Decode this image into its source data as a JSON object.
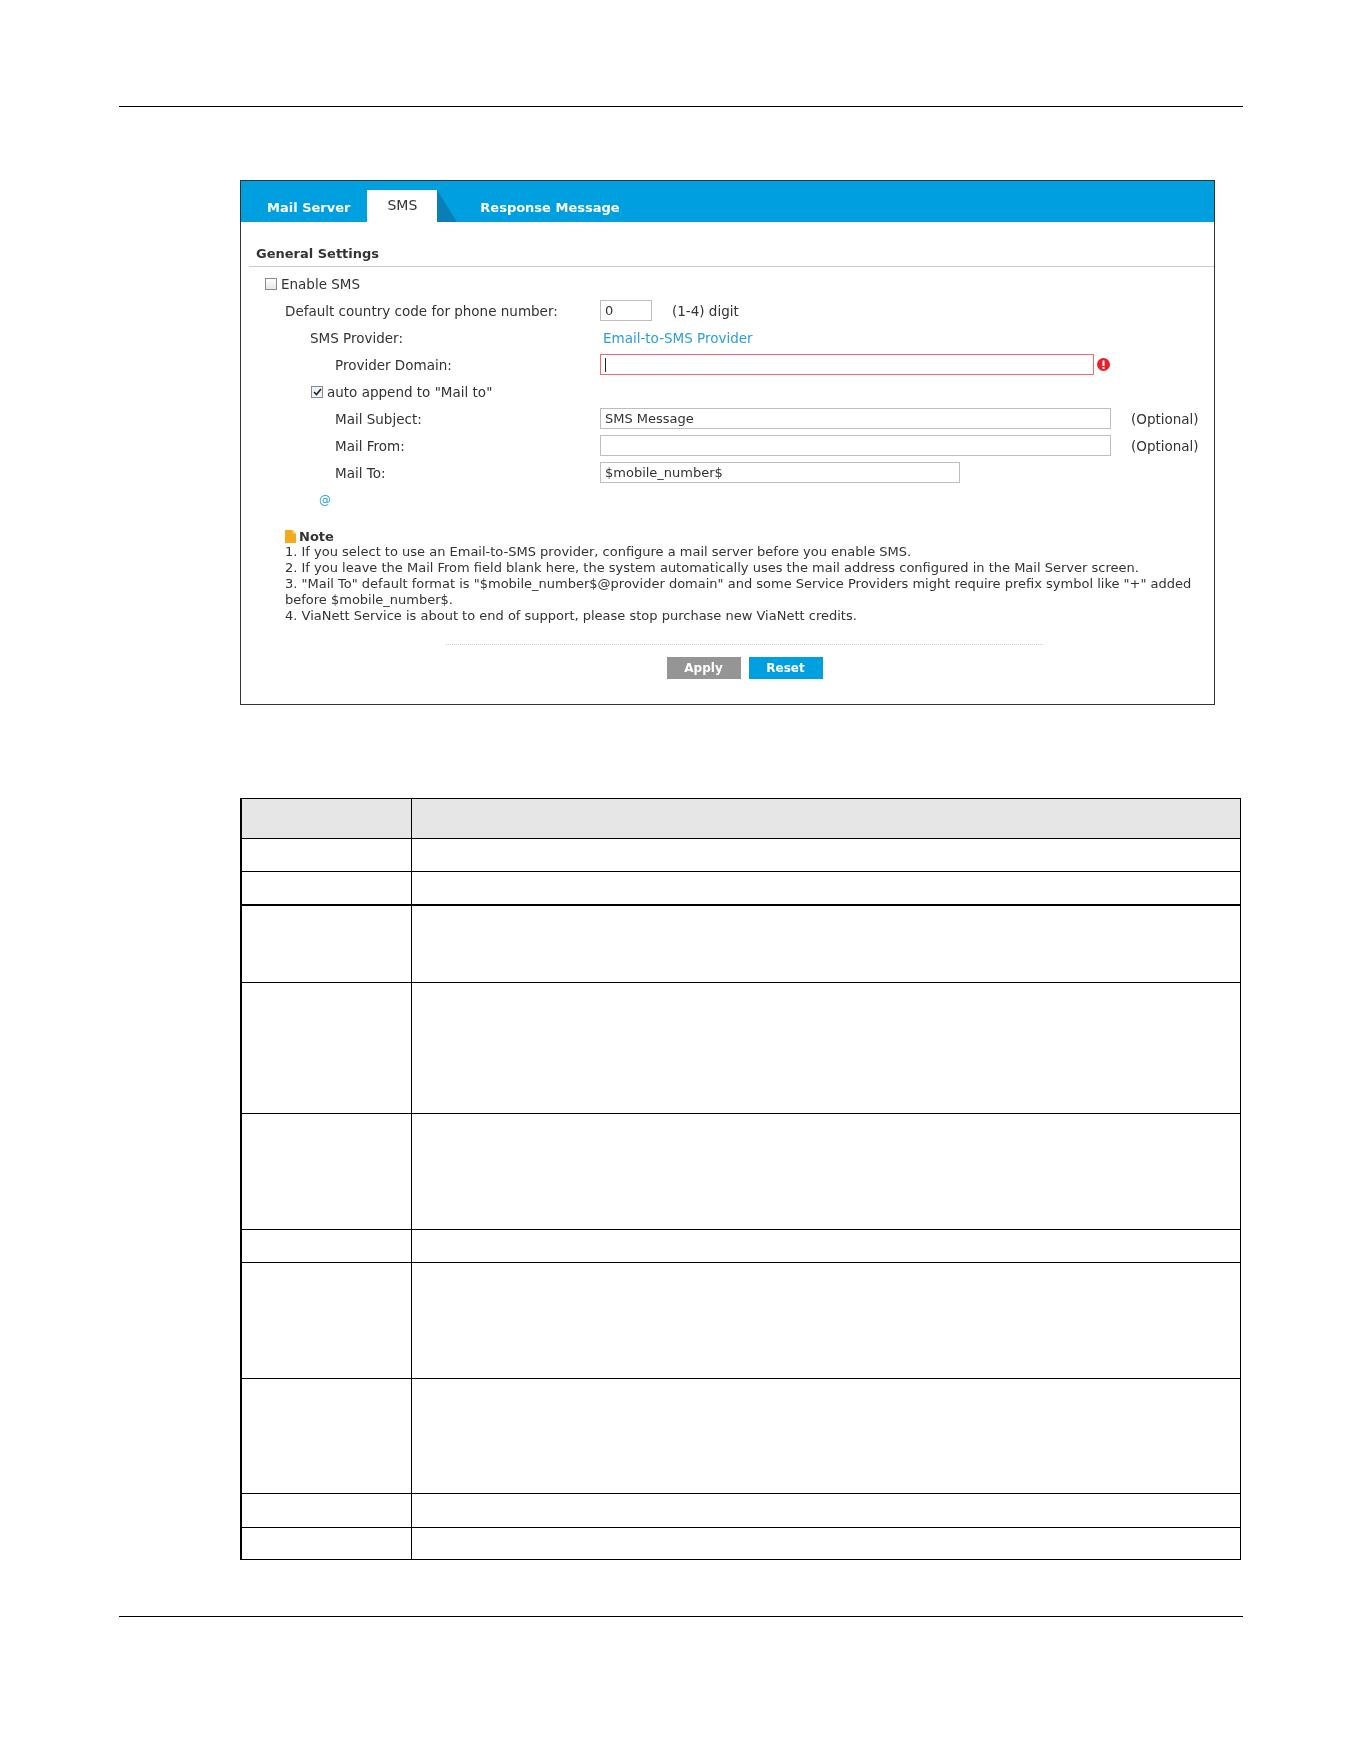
{
  "tabs": [
    {
      "label": "Mail Server",
      "selected": false
    },
    {
      "label": "SMS",
      "selected": true
    },
    {
      "label": "Response Message",
      "selected": false
    }
  ],
  "general_settings": {
    "title": "General Settings",
    "enable_sms": {
      "label": "Enable SMS",
      "checked": false
    },
    "country_code": {
      "label": "Default country code for phone number:",
      "value": "0",
      "hint": "(1-4) digit"
    },
    "sms_provider": {
      "label": "SMS Provider:",
      "value": "Email-to-SMS Provider"
    },
    "provider_domain": {
      "label": "Provider Domain:",
      "error": true,
      "focused": true
    },
    "auto_append": {
      "label": "auto append to \"Mail to\"",
      "checked": true
    },
    "mail_subject": {
      "label": "Mail Subject:",
      "value": "SMS Message",
      "hint": "(Optional)"
    },
    "mail_from": {
      "label": "Mail From:",
      "hint": "(Optional)"
    },
    "mail_to": {
      "label": "Mail To:",
      "value": "$mobile_number$"
    },
    "append_symbol": "@"
  },
  "note": {
    "title": "Note",
    "lines": [
      "1. If you select to use an Email-to-SMS provider, configure a mail server before you enable SMS.",
      "2. If you leave the Mail From field blank here, the system automatically uses the mail address configured in the Mail Server screen.",
      "3. \"Mail To\" default format is \"$mobile_number$@provider domain\" and some Service Providers might require prefix symbol like \"+\" added before $mobile_number$.",
      "4. ViaNett Service is about to end of support, please stop purchase new ViaNett credits."
    ]
  },
  "buttons": [
    {
      "label": "Apply",
      "disabled": true
    },
    {
      "label": "Reset",
      "disabled": false
    }
  ]
}
